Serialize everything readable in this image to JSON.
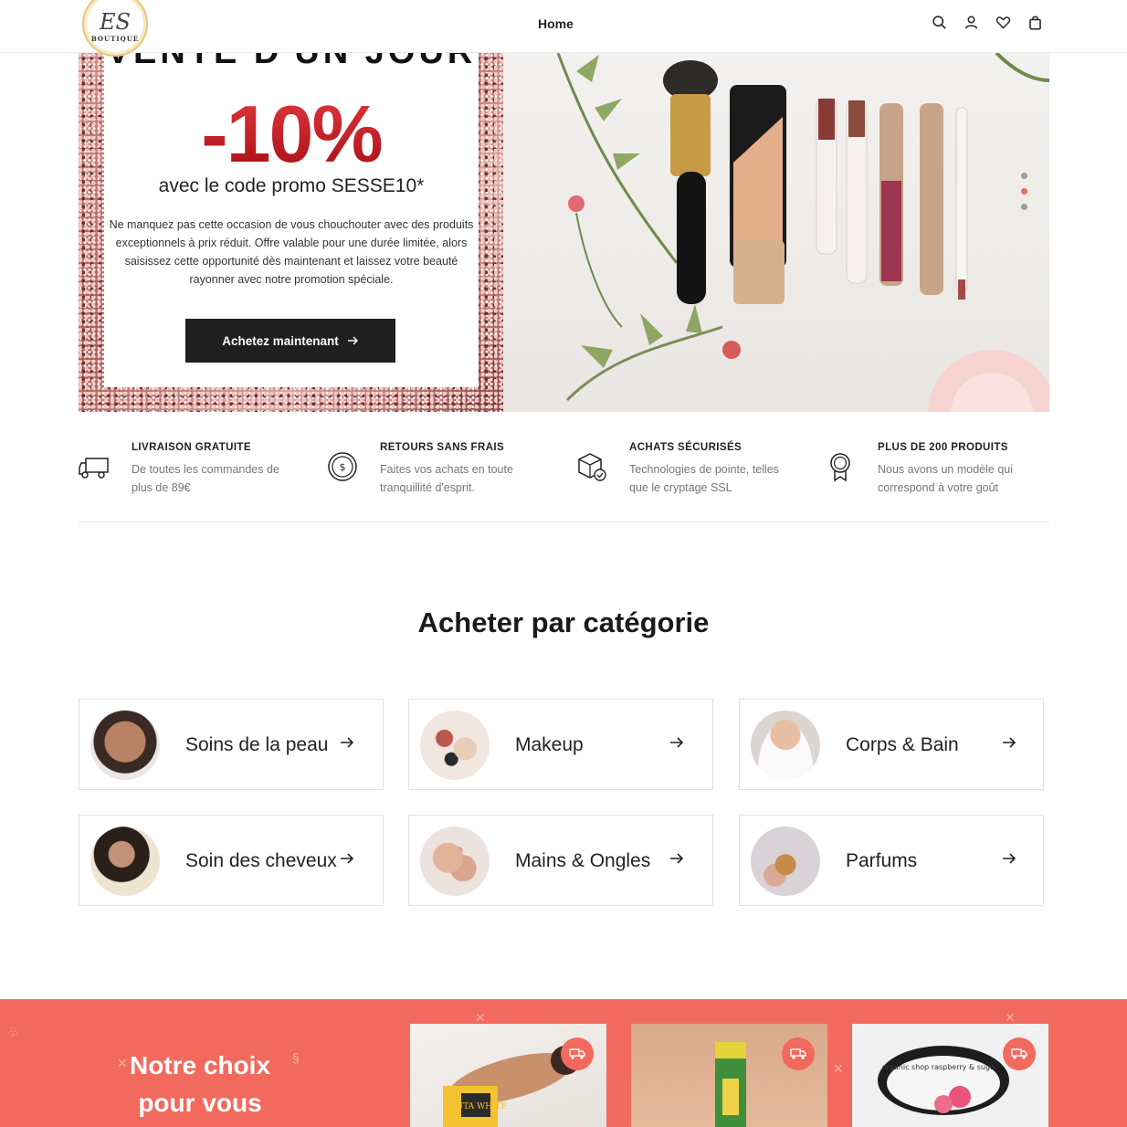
{
  "header": {
    "logo": {
      "monogram": "ES",
      "text": "BOUTIQUE"
    },
    "nav": {
      "home": "Home"
    },
    "icons": [
      "search-icon",
      "user-icon",
      "heart-icon",
      "bag-icon"
    ]
  },
  "hero": {
    "top_text": "VENTE D'UN JOUR",
    "discount": "-10%",
    "code_line": "avec le code promo SESSE10*",
    "description": "Ne manquez pas cette occasion de vous chouchouter avec des produits exceptionnels à prix réduit. Offre valable pour une durée limitée, alors saisissez cette opportunité dès maintenant et laissez votre beauté rayonner avec notre promotion spéciale.",
    "cta": "Achetez maintenant",
    "slider": {
      "slides": 3,
      "active": 2
    },
    "colors": {
      "discount": "#c8141c",
      "button": "#1f1f1f"
    }
  },
  "features": [
    {
      "icon": "truck-icon",
      "title": "LIVRAISON GRATUITE",
      "text": "De toutes les commandes de plus de 89€"
    },
    {
      "icon": "coin-icon",
      "title": "RETOURS SANS FRAIS",
      "text": "Faites vos achats en toute tranquillité d'esprit."
    },
    {
      "icon": "secure-box-icon",
      "title": "ACHATS SÉCURISÉS",
      "text": "Technologies de pointe, telles que le cryptage SSL"
    },
    {
      "icon": "award-badge-icon",
      "title": "PLUS DE 200 PRODUITS",
      "text": "Nous avons un modèle qui correspond à votre goût"
    }
  ],
  "categories": {
    "title": "Acheter par catégorie",
    "items": [
      {
        "label": "Soins de la peau"
      },
      {
        "label": "Makeup"
      },
      {
        "label": "Corps & Bain"
      },
      {
        "label": "Soin des cheveux"
      },
      {
        "label": "Mains & Ongles"
      },
      {
        "label": "Parfums"
      }
    ]
  },
  "band": {
    "title_line1": "Notre choix",
    "title_line2": "pour vous",
    "color": "#f26a5d",
    "products": [
      {
        "label_text": "GLUTA WHITE"
      },
      {
        "label_text": ""
      },
      {
        "label_text": "organic shop raspberry & sugar"
      }
    ]
  }
}
